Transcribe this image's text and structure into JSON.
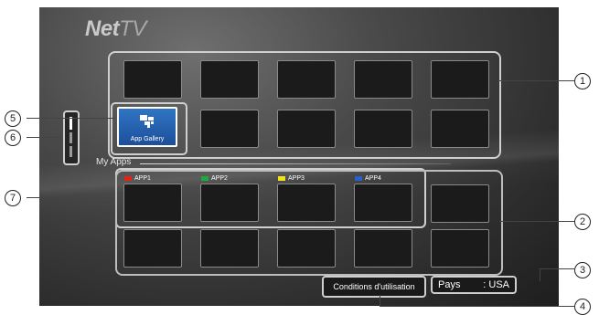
{
  "logo": {
    "bold": "Net",
    "thin": "TV"
  },
  "app_gallery": {
    "label": "App Gallery"
  },
  "my_apps": {
    "title": "My Apps",
    "apps": [
      {
        "label": "APP1",
        "color": "#e2231a"
      },
      {
        "label": "APP2",
        "color": "#1faa3a"
      },
      {
        "label": "APP3",
        "color": "#f2e01a"
      },
      {
        "label": "APP4",
        "color": "#2c5fc9"
      }
    ]
  },
  "terms_button": {
    "label": "Conditions d'utilisation"
  },
  "country": {
    "label": "Pays",
    "value": ": USA"
  },
  "callouts": [
    "1",
    "2",
    "3",
    "4",
    "5",
    "6",
    "7"
  ],
  "icons": [
    "app-gallery-icon"
  ]
}
